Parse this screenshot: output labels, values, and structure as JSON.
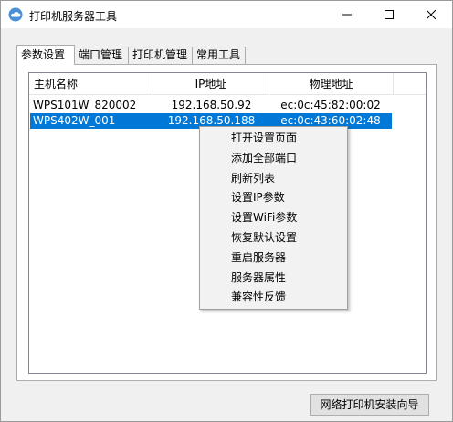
{
  "window": {
    "title": "打印机服务器工具",
    "icon": "cloud-icon",
    "controls": [
      "minimize-icon",
      "maximize-icon",
      "close-icon"
    ]
  },
  "tabs": [
    {
      "label": "参数设置",
      "active": true
    },
    {
      "label": "端口管理",
      "active": false
    },
    {
      "label": "打印机管理",
      "active": false
    },
    {
      "label": "常用工具",
      "active": false
    }
  ],
  "list": {
    "columns": [
      "主机名称",
      "IP地址",
      "物理地址"
    ],
    "rows": [
      {
        "host": "WPS101W_820002",
        "ip": "192.168.50.92",
        "mac": "ec:0c:45:82:00:02",
        "selected": false
      },
      {
        "host": "WPS402W_001",
        "ip": "192.168.50.188",
        "mac": "ec:0c:43:60:02:48",
        "selected": true
      }
    ]
  },
  "context_menu": {
    "items": [
      "打开设置页面",
      "添加全部端口",
      "刷新列表",
      "设置IP参数",
      "设置WiFi参数",
      "恢复默认设置",
      "重启服务器",
      "服务器属性",
      "兼容性反馈"
    ]
  },
  "footer": {
    "wizard_button": "网络打印机安装向导"
  },
  "colors": {
    "selection": "#0078d7",
    "icon": "#4a90d9"
  }
}
